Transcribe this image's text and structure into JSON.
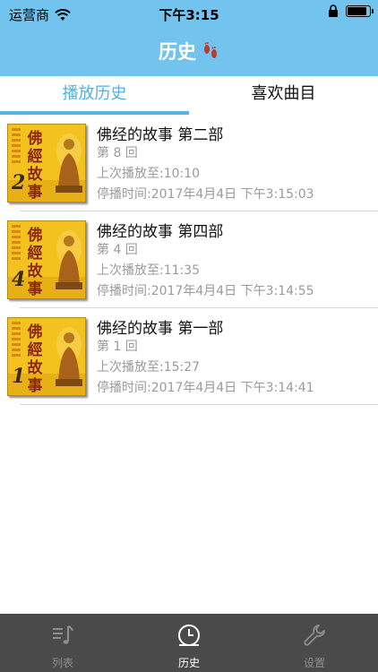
{
  "status_bar": {
    "carrier": "运营商",
    "time": "下午3:15",
    "battery_level": 0.95
  },
  "nav": {
    "title": "历史",
    "title_icon": "footprints-icon"
  },
  "tabs": [
    {
      "label": "播放历史",
      "active": true
    },
    {
      "label": "喜欢曲目",
      "active": false
    }
  ],
  "history": [
    {
      "cover_number": "2",
      "cover_title": "佛經故事",
      "name": "佛经的故事 第二部",
      "episode": "第 8 回",
      "position": "上次播放至:10:10",
      "stopped_at": "停播时间:2017年4月4日 下午3:15:03"
    },
    {
      "cover_number": "4",
      "cover_title": "佛經故事",
      "name": "佛经的故事 第四部",
      "episode": "第 4 回",
      "position": "上次播放至:11:35",
      "stopped_at": "停播时间:2017年4月4日 下午3:14:55"
    },
    {
      "cover_number": "1",
      "cover_title": "佛經故事",
      "name": "佛经的故事 第一部",
      "episode": "第 1 回",
      "position": "上次播放至:15:27",
      "stopped_at": "停播时间:2017年4月4日 下午3:14:41"
    }
  ],
  "tabbar": [
    {
      "label": "列表",
      "icon": "music-list-icon",
      "active": false
    },
    {
      "label": "历史",
      "icon": "clock-icon",
      "active": true
    },
    {
      "label": "设置",
      "icon": "wrench-icon",
      "active": false
    }
  ],
  "colors": {
    "header": "#72c3ee",
    "accent": "#56b3e6",
    "tabbar": "#4a4a4a"
  }
}
